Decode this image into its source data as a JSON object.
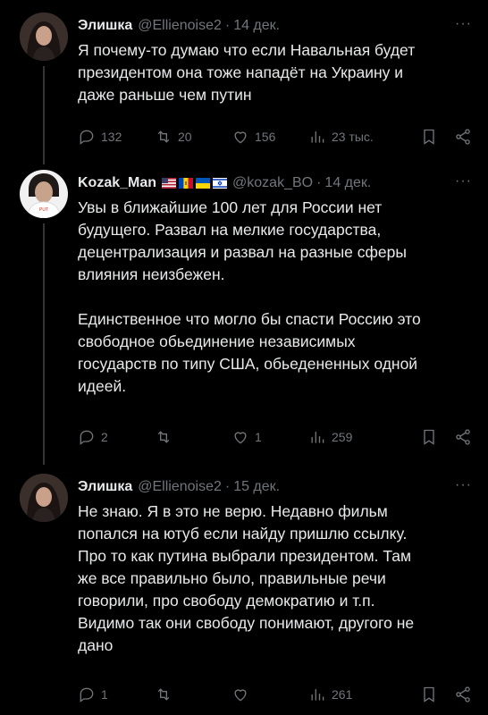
{
  "tweets": [
    {
      "name": "Элишка",
      "handle": "@Ellienoise2",
      "date": "14 дек.",
      "text": "Я почему-то думаю что если Навальная будет\nпрезидентом она тоже нападёт на Украину и\nдаже раньше чем путин",
      "stats": {
        "replies": "132",
        "reposts": "20",
        "likes": "156",
        "views": "23 тыс."
      }
    },
    {
      "name": "Kozak_Man",
      "handle": "@kozak_BO",
      "date": "14 дек.",
      "text": "Увы в ближайшие 100 лет для России нет\nбудущего. Развал на мелкие государства,\nдецентрализация и развал на разные сферы\nвлияния неизбежен.\n\nЕдинственное что могло бы спасти Россию это\nсвободное обьединение независимых\nгосударств по типу США, обьедененных одной\nидеей.",
      "stats": {
        "replies": "2",
        "reposts": "",
        "likes": "1",
        "views": "259"
      }
    },
    {
      "name": "Элишка",
      "handle": "@Ellienoise2",
      "date": "15 дек.",
      "text": "Не знаю. Я в это не верю. Недавно фильм\nпопался на ютуб если найду пришлю ссылку.\nПро то как путина выбрали президентом. Там\nже все правильно было, правильные речи\nговорили, про свободу демократию и т.п.\nВидимо так они свободу понимают, другого не\nдано",
      "stats": {
        "replies": "1",
        "reposts": "",
        "likes": "",
        "views": "261"
      }
    }
  ],
  "more_label": "···",
  "dot": "·",
  "icons": [
    "reply-icon",
    "repost-icon",
    "like-icon",
    "views-icon",
    "bookmark-icon",
    "share-icon"
  ],
  "flags": [
    "us-flag",
    "moldova-flag",
    "ukraine-flag",
    "israel-flag"
  ]
}
